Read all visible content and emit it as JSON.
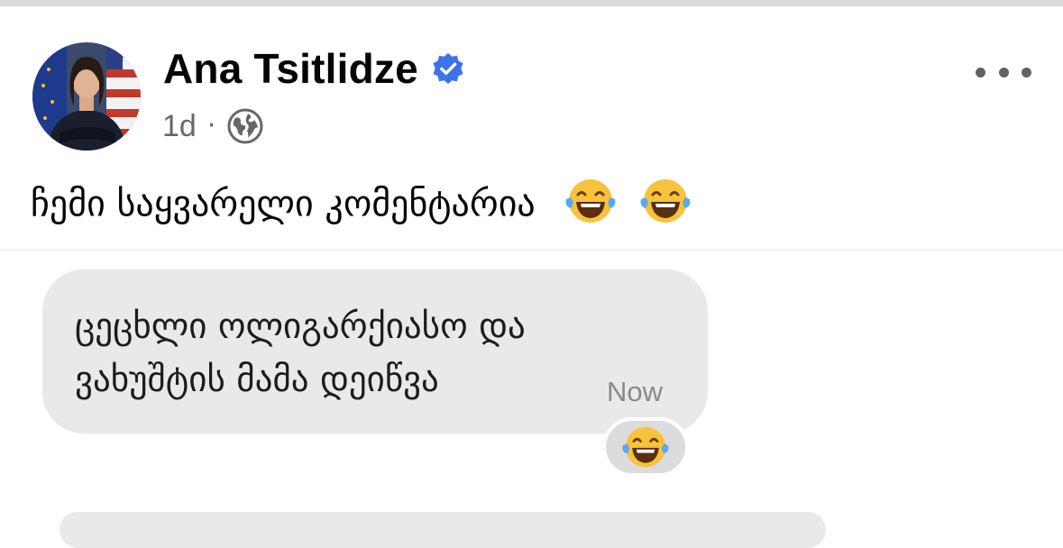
{
  "post": {
    "author_name": "Ana Tsitlidze",
    "verified": true,
    "timestamp": "1d",
    "separator": "·",
    "privacy_icon": "globe-icon",
    "more_icon": "more-horizontal-icon",
    "text": "ჩემი საყვარელი კომენტარია",
    "text_emojis": [
      "laughing-tears-emoji",
      "laughing-tears-emoji"
    ]
  },
  "message": {
    "line1": "ცეცხლი ოლიგარქიასო და",
    "line2": "ვახუშტის მამა დეიწვა",
    "time": "Now",
    "reaction": "laughing-tears-emoji"
  },
  "colors": {
    "verified_blue": "#3b73e8",
    "bubble_bg": "#e9e9eb",
    "meta_gray": "#65676b"
  }
}
